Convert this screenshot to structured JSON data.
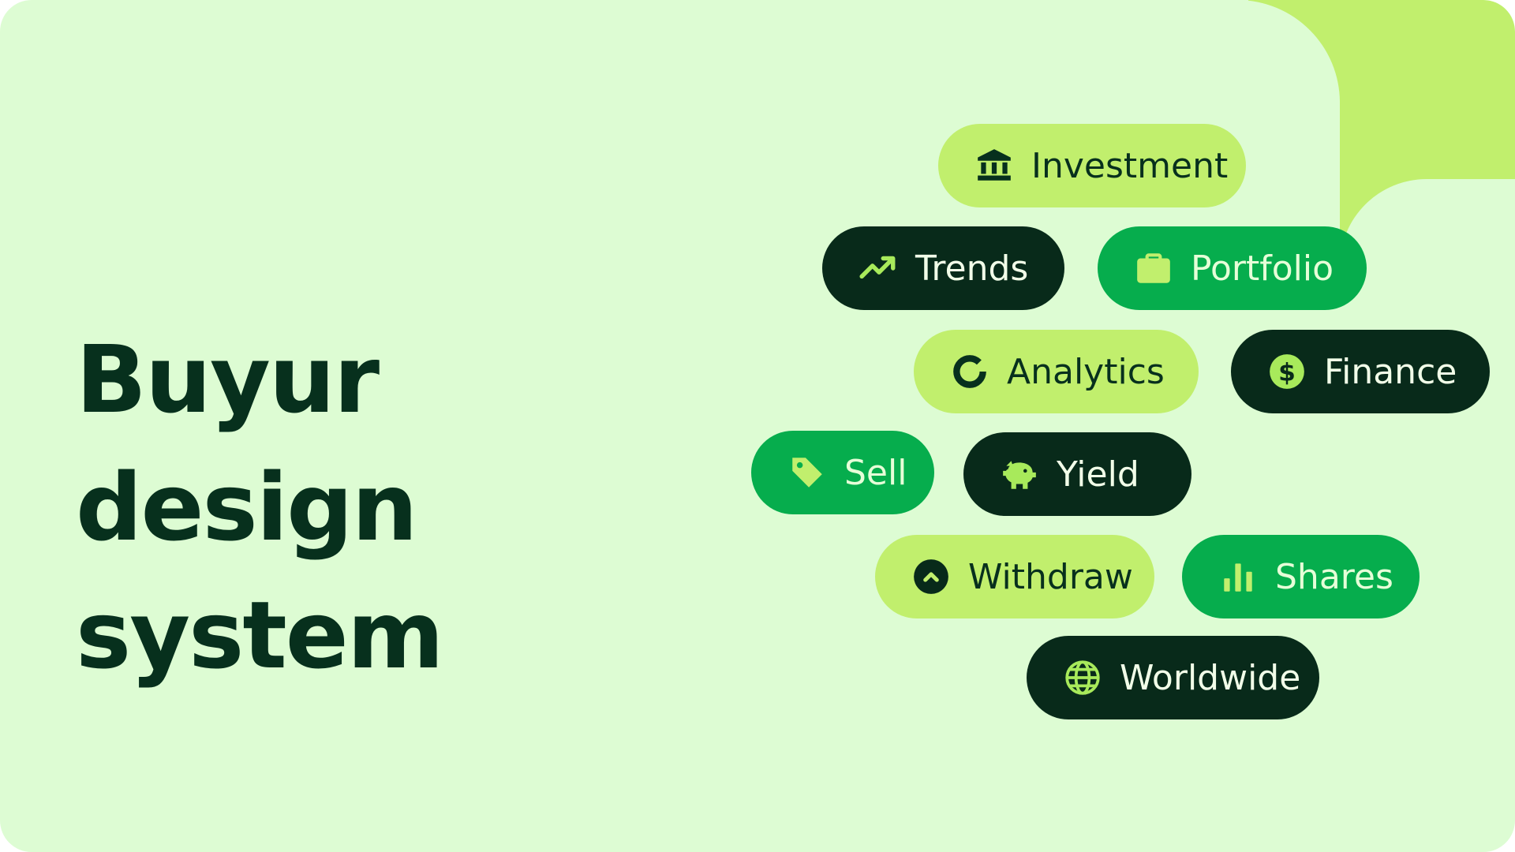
{
  "title": {
    "line1": "Buyur design",
    "line2": "system"
  },
  "colors": {
    "background": "#ddfcd3",
    "accent_lime": "#c1ef6d",
    "accent_green": "#06ad4d",
    "dark": "#082a1a",
    "text_dark": "#07301d"
  },
  "chips": [
    {
      "label": "Investment",
      "icon": "bank-icon",
      "style": "lime"
    },
    {
      "label": "Trends",
      "icon": "trending-up-icon",
      "style": "dark"
    },
    {
      "label": "Portfolio",
      "icon": "briefcase-icon",
      "style": "green"
    },
    {
      "label": "Analytics",
      "icon": "donut-chart-icon",
      "style": "lime"
    },
    {
      "label": "Finance",
      "icon": "dollar-coin-icon",
      "style": "dark"
    },
    {
      "label": "Sell",
      "icon": "tag-icon",
      "style": "green"
    },
    {
      "label": "Yield",
      "icon": "piggy-bank-icon",
      "style": "dark"
    },
    {
      "label": "Withdraw",
      "icon": "chevron-up-circle-icon",
      "style": "lime"
    },
    {
      "label": "Shares",
      "icon": "bar-chart-icon",
      "style": "green"
    },
    {
      "label": "Worldwide",
      "icon": "globe-icon",
      "style": "dark"
    }
  ]
}
